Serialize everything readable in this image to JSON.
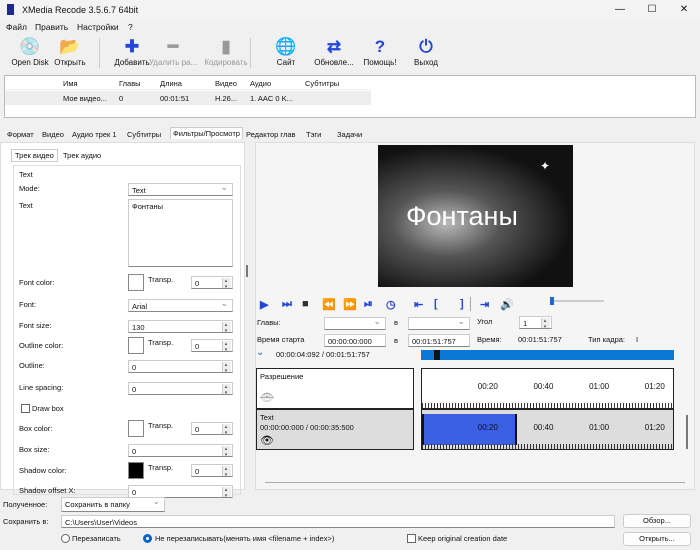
{
  "window": {
    "title": "XMedia Recode 3.5.6.7 64bit",
    "minimize": "—",
    "maximize": "☐",
    "close": "✕"
  },
  "menu": [
    "Файл",
    "Править",
    "Настройки",
    "?"
  ],
  "toolbar": [
    {
      "label": "Open Disk",
      "icon": "disc-icon",
      "glyph": "💿",
      "enabled": true
    },
    {
      "label": "Открыть",
      "icon": "folder-icon",
      "glyph": "📂",
      "enabled": true
    },
    {
      "label": "Добавить",
      "icon": "plus-icon",
      "glyph": "✚",
      "enabled": true
    },
    {
      "label": "Удалить ра...",
      "icon": "minus-icon",
      "glyph": "━",
      "enabled": false
    },
    {
      "label": "Кодировать",
      "icon": "encode-icon",
      "glyph": "▮",
      "enabled": false
    },
    {
      "label": "Сайт",
      "icon": "globe-icon",
      "glyph": "🌐",
      "enabled": true
    },
    {
      "label": "Обновле...",
      "icon": "refresh-icon",
      "glyph": "⇄",
      "enabled": true
    },
    {
      "label": "Помощь!",
      "icon": "help-icon",
      "glyph": "?",
      "enabled": true
    },
    {
      "label": "Выход",
      "icon": "power-icon",
      "glyph": "⏻",
      "enabled": true
    }
  ],
  "filelist": {
    "columns": [
      "Имя",
      "Главы",
      "Длина",
      "Видео",
      "Аудио",
      "Субтитры"
    ],
    "rows": [
      [
        "Мое видео...",
        "0",
        "00:01:51",
        "H.26...",
        "1. AAC 0 K...",
        ""
      ]
    ]
  },
  "tabs": [
    "Формат",
    "Видео",
    "Аудио трек 1",
    "Субтитры",
    "Фильтры/Просмотр",
    "Редактор глав",
    "Тэги",
    "Задачи"
  ],
  "active_tab": "Фильтры/Просмотр",
  "subtabs": [
    "Трек видео",
    "Трек аудио"
  ],
  "filter": {
    "group": "Text",
    "mode_label": "Mode:",
    "mode": "Text",
    "text_label": "Text",
    "text": "Фонтаны",
    "transp": "Transp.",
    "rows": [
      {
        "label": "Font color:",
        "type": "color",
        "color": "#ffffff",
        "transp": "0"
      },
      {
        "label": "Font:",
        "type": "select",
        "value": "Arial"
      },
      {
        "label": "Font size:",
        "type": "spin",
        "value": "130"
      },
      {
        "label": "Outline color:",
        "type": "color",
        "color": "#ffffff",
        "transp": "0"
      },
      {
        "label": "Outline:",
        "type": "spin",
        "value": "0"
      },
      {
        "label": "Line spacing:",
        "type": "spin",
        "value": "0"
      },
      {
        "label": "Draw box",
        "type": "check",
        "checked": false
      },
      {
        "label": "Box color:",
        "type": "color",
        "color": "#ffffff",
        "transp": "0"
      },
      {
        "label": "Box size:",
        "type": "spin",
        "value": "0"
      },
      {
        "label": "Shadow color:",
        "type": "color",
        "color": "#000000",
        "transp": "0"
      },
      {
        "label": "Shadow offset X:",
        "type": "spin",
        "value": "0"
      }
    ]
  },
  "preview": {
    "overlay_text": "Фонтаны"
  },
  "player": {
    "chapters_label": "Главы:",
    "to": "в",
    "angle_label": "Угол",
    "angle": "1",
    "start_label": "Время старта",
    "start": "00:00:00:000",
    "end": "00:01:51:757",
    "time_label": "Время:",
    "time": "00:01:51:757",
    "frame_type_label": "Тип кадра:",
    "frame_type": "I",
    "position": "00:00:04:092 / 00:01:51:757",
    "seek_fraction": 0.037,
    "volume_fraction": 0.05
  },
  "timeline": {
    "ticks": [
      "00:20",
      "00:40",
      "01:00",
      "01:20"
    ],
    "tracks": [
      {
        "name": "Разрешение",
        "range": "",
        "visible": false
      },
      {
        "name": "Text",
        "range": "00:00:00:000 / 00:00:35:500",
        "visible": true
      }
    ],
    "clip_color": "#3a5fe0"
  },
  "output": {
    "received_label": "Полученное:",
    "received": "Сохранить в папку",
    "save_label": "Сохранить в:",
    "path": "C:\\Users\\User\\Videos",
    "browse": "Обзор...",
    "open": "Открыть...",
    "overwrite": "Перезаписать",
    "no_overwrite": "Не перезаписывать(менять имя <filename + index>)",
    "keep_date": "Keep original creation date"
  }
}
